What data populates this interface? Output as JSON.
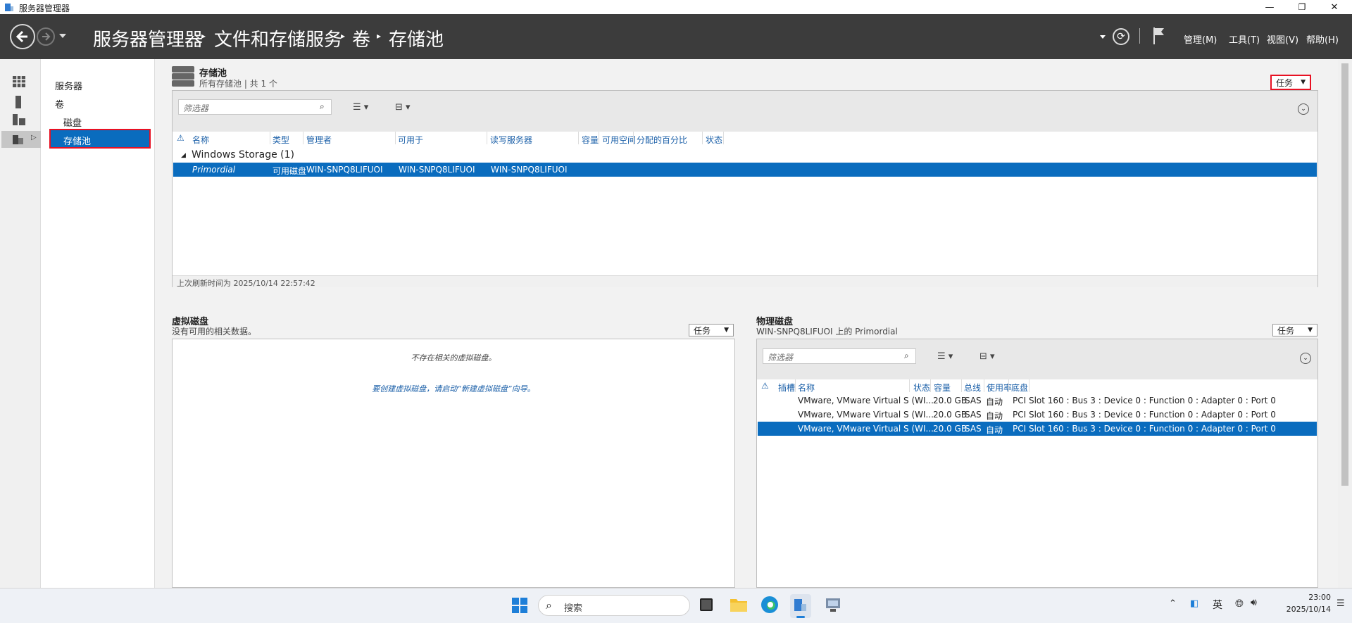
{
  "window": {
    "title": "服务器管理器",
    "min": "—",
    "max": "❐",
    "close": "✕"
  },
  "breadcrumb": [
    "服务器管理器",
    "文件和存储服务",
    "卷",
    "存储池"
  ],
  "header_menu": [
    "管理(M)",
    "工具(T)",
    "视图(V)",
    "帮助(H)"
  ],
  "nav": {
    "items": [
      "服务器",
      "卷",
      "磁盘",
      "存储池"
    ]
  },
  "pools": {
    "title": "存储池",
    "subtitle": "所有存储池 | 共 1 个",
    "tasks": "任务",
    "filter_placeholder": "筛选器",
    "columns": [
      "名称",
      "类型",
      "管理者",
      "可用于",
      "读写服务器",
      "容量",
      "可用空间",
      "分配的百分比",
      "状态"
    ],
    "group": "Windows Storage (1)",
    "rows": [
      {
        "name": "Primordial",
        "type": "可用磁盘",
        "managed_by": "WIN-SNPQ8LIFUOI",
        "available_to": "WIN-SNPQ8LIFUOI",
        "rw_server": "WIN-SNPQ8LIFUOI"
      }
    ],
    "footer": "上次刷新时间为 2025/10/14 22:57:42"
  },
  "vdisk": {
    "title": "虚拟磁盘",
    "subtitle": "没有可用的相关数据。",
    "tasks": "任务",
    "empty": "不存在相关的虚拟磁盘。",
    "hint": "要创建虚拟磁盘，请启动“新建虚拟磁盘”向导。"
  },
  "pdisk": {
    "title": "物理磁盘",
    "subtitle": "WIN-SNPQ8LIFUOI 上的 Primordial",
    "tasks": "任务",
    "filter_placeholder": "筛选器",
    "columns": [
      "插槽",
      "名称",
      "状态",
      "容量",
      "总线",
      "使用率",
      "底盘"
    ],
    "rows": [
      {
        "name": "VMware, VMware Virtual S (WI...",
        "capacity": "20.0 GB",
        "bus": "SAS",
        "usage": "自动",
        "chassis": "PCI Slot 160 : Bus 3 : Device 0 : Function 0 : Adapter 0 : Port 0"
      },
      {
        "name": "VMware, VMware Virtual S (WI...",
        "capacity": "20.0 GB",
        "bus": "SAS",
        "usage": "自动",
        "chassis": "PCI Slot 160 : Bus 3 : Device 0 : Function 0 : Adapter 0 : Port 0"
      },
      {
        "name": "VMware, VMware Virtual S (WI...",
        "capacity": "20.0 GB",
        "bus": "SAS",
        "usage": "自动",
        "chassis": "PCI Slot 160 : Bus 3 : Device 0 : Function 0 : Adapter 0 : Port 0"
      }
    ]
  },
  "taskbar": {
    "search": "搜索",
    "lang": "英",
    "time": "23:00",
    "date": "2025/10/14"
  }
}
